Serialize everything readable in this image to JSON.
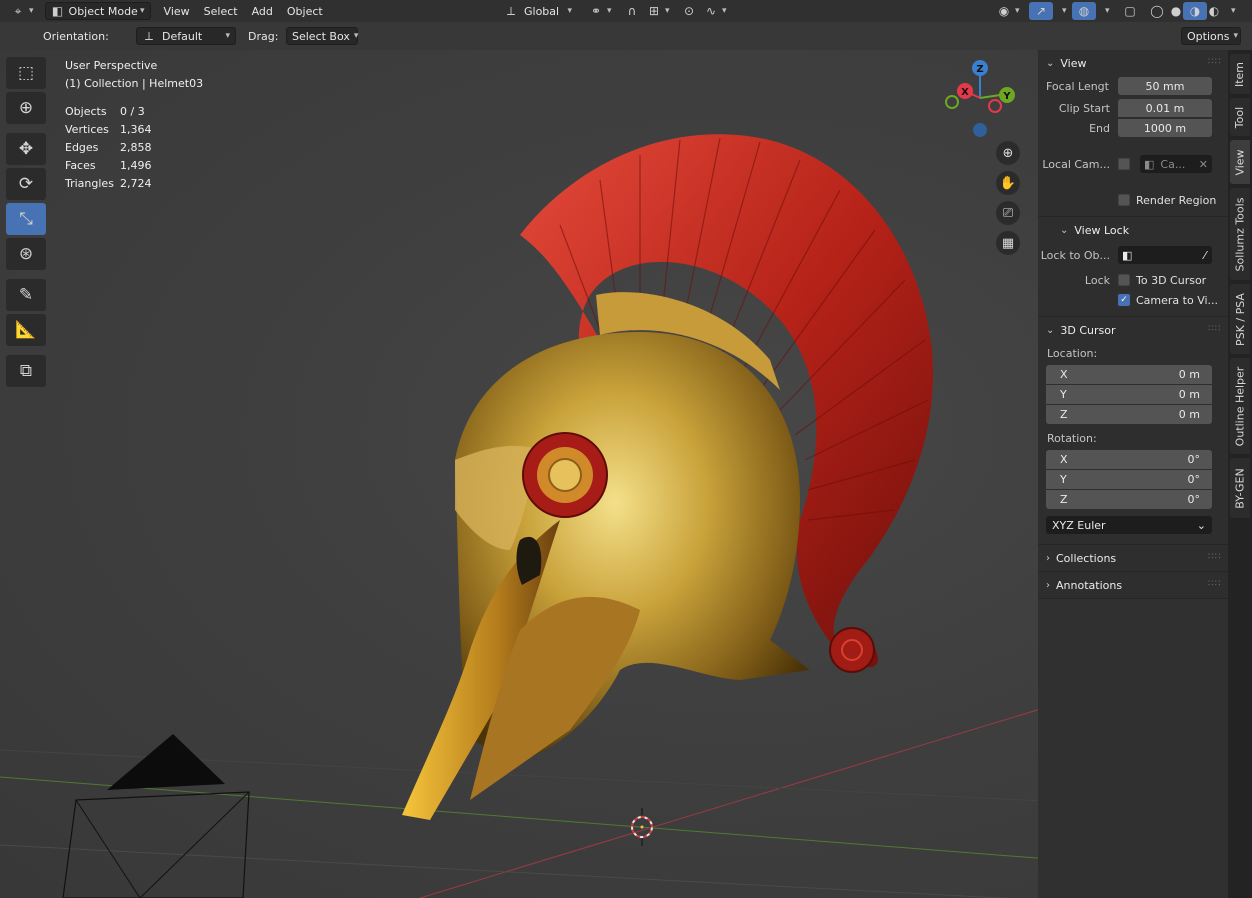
{
  "header": {
    "editor_icon": "cube-axes-icon",
    "mode": "Object Mode",
    "menus": [
      "View",
      "Select",
      "Add",
      "Object"
    ],
    "transform_orientation": "Global",
    "options_label": "Options"
  },
  "tool_settings": {
    "orientation_label": "Orientation:",
    "orientation_value": "Default",
    "drag_label": "Drag:",
    "drag_value": "Select Box"
  },
  "viewport": {
    "perspective": "User Perspective",
    "collection": "(1) Collection | Helmet03",
    "stats": [
      {
        "label": "Objects",
        "value": "0 / 3"
      },
      {
        "label": "Vertices",
        "value": "1,364"
      },
      {
        "label": "Edges",
        "value": "2,858"
      },
      {
        "label": "Faces",
        "value": "1,496"
      },
      {
        "label": "Triangles",
        "value": "2,724"
      }
    ],
    "gizmo": {
      "x": "X",
      "y": "Y",
      "z": "Z"
    },
    "colors": {
      "x_axis": "#e5394b",
      "y_axis": "#6ea724",
      "z_axis": "#3a80d0",
      "active": "#4772b3"
    }
  },
  "toolbar": [
    {
      "name": "select-box-tool",
      "icon": "select-box-icon",
      "active": false
    },
    {
      "name": "cursor-tool",
      "icon": "cursor-icon",
      "active": false
    },
    {
      "name": "move-tool",
      "icon": "move-icon",
      "active": false
    },
    {
      "name": "rotate-tool",
      "icon": "rotate-icon",
      "active": false
    },
    {
      "name": "scale-tool",
      "icon": "scale-icon",
      "active": true
    },
    {
      "name": "transform-tool",
      "icon": "transform-icon",
      "active": false
    },
    {
      "name": "annotate-tool",
      "icon": "annotate-icon",
      "active": false
    },
    {
      "name": "measure-tool",
      "icon": "measure-icon",
      "active": false
    },
    {
      "name": "add-cube-tool",
      "icon": "add-cube-icon",
      "active": false
    }
  ],
  "sidebar": {
    "view_panel": {
      "title": "View",
      "focal_label": "Focal Lengt",
      "focal_value": "50 mm",
      "clip_start_label": "Clip Start",
      "clip_start_value": "0.01 m",
      "clip_end_label": "End",
      "clip_end_value": "1000 m",
      "local_cam_label": "Local Cam...",
      "local_cam_value": "Ca...",
      "render_region_label": "Render Region"
    },
    "view_lock": {
      "title": "View Lock",
      "lock_obj_label": "Lock to Ob...",
      "lock_label": "Lock",
      "to_cursor_label": "To 3D Cursor",
      "camera_label": "Camera to Vi..."
    },
    "cursor_panel": {
      "title": "3D Cursor",
      "location_label": "Location:",
      "location": [
        {
          "axis": "X",
          "value": "0 m"
        },
        {
          "axis": "Y",
          "value": "0 m"
        },
        {
          "axis": "Z",
          "value": "0 m"
        }
      ],
      "rotation_label": "Rotation:",
      "rotation": [
        {
          "axis": "X",
          "value": "0°"
        },
        {
          "axis": "Y",
          "value": "0°"
        },
        {
          "axis": "Z",
          "value": "0°"
        }
      ],
      "rotation_mode": "XYZ Euler"
    },
    "collections_title": "Collections",
    "annotations_title": "Annotations"
  },
  "tabs": [
    "Item",
    "Tool",
    "View",
    "Sollumz Tools",
    "PSK / PSA",
    "Outline Helper",
    "BY-GEN"
  ]
}
